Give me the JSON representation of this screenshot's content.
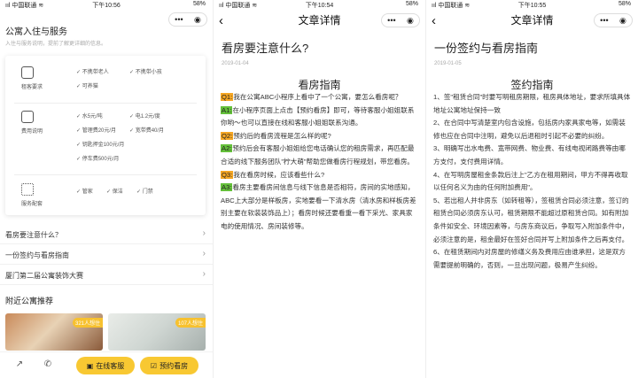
{
  "panel1": {
    "status": {
      "carrier": "ııl 中国联通 ≋",
      "time": "下午10:56",
      "battery": "58%"
    },
    "header_title": "公寓入住与服务",
    "header_sub": "入住与服务说明，提前了解更详细的信息。",
    "requirements": {
      "label": "租客要求",
      "tags": [
        "不携带老人",
        "不携带小孩",
        "可养猫"
      ]
    },
    "fees": {
      "label": "费用说明",
      "tags": [
        "水5元/吨",
        "电1.2元/度",
        "管理费20元/月",
        "宽带费40/月",
        "钥匙押金100元/月",
        "停车费500元/月"
      ]
    },
    "services": {
      "label": "服务配套",
      "tags": [
        "管家",
        "保洁",
        "门禁"
      ]
    },
    "links": [
      "看房要注意什么？",
      "一份签约与看房指南",
      "厦门第二届公寓装饰大赛"
    ],
    "nearby_title": "附近公寓推荐",
    "nearby": [
      {
        "badge": "321人想住"
      },
      {
        "badge": "107人想住"
      }
    ],
    "buttons": {
      "service": "在线客服",
      "viewing": "预约看房"
    }
  },
  "panel2": {
    "status": {
      "carrier": "ııl 中国联通 ≋",
      "time": "下午10:54",
      "battery": "58%"
    },
    "nav_title": "文章详情",
    "title": "看房要注意什么?",
    "date": "2019-01-04",
    "heading": "看房指南",
    "qa": [
      {
        "tag": "Q1:",
        "text": "我在公寓ABC小程序上看中了一个公寓，要怎么看房呢？"
      },
      {
        "tag": "A1:",
        "text": "在小程序页面上点击【预约看房】即可，等待客服小姐姐联系你哟～也可以直接在线和客服小姐姐联系沟通。"
      },
      {
        "tag": "Q2:",
        "text": "预约后的看房流程是怎么样的呢?"
      },
      {
        "tag": "A2:",
        "text": "预约后会有客服小姐姐给您电话确认您的租房需求，再匹配最合适的线下服务团队\"柠大萌\"帮助您做看房行程规划，带您看房。"
      },
      {
        "tag": "Q3:",
        "text": "我在看房时候，应该看些什么?"
      },
      {
        "tag": "A3:",
        "text": "看房主要看房间信息与线下信息是否相符，房间的实地感知，ABC上大部分是样板房，实地要看一下清水房（清水房和样板房差别主要在软装装饰品上）；看房时候还要看重一看下采光、家具家电的使用情况、房间装修等。"
      }
    ]
  },
  "panel3": {
    "status": {
      "carrier": "ııl 中国联通 ≋",
      "time": "下午10:55",
      "battery": "58%"
    },
    "nav_title": "文章详情",
    "title": "一份签约与看房指南",
    "date": "2019-01-05",
    "heading": "签约指南",
    "items": [
      "1、签\"租赁合同\"时要写明租房期限，租房具体地址，要求所填具体地址公寓地址保持一致",
      "2、在合同中写清楚室内包含设施，包括房内家具家电等，如需装修也应在合同中注明，避免以后退租时引起不必要的纠纷。",
      "3、明确写出水电费、宽带网费、物业费、有线电视闭路费等由哪方支付，支付费用详情。",
      "4、在写明房屋租金条款后注上\"乙方在租用期间，甲方不得再收取以任何名义为由的任何附加费用\"。",
      "5、若出租人并非房东（如转租等），签租赁合同必须注意，签订的租赁合同必须房东认可，租赁期限不能超过原租赁合同。如有附加条件如安全、环境因素等，与房东商议后，争取写入附加条件中，必须注意的是，租金最好在签好合同并写上附加条件之后再支付。",
      "6、在租赁期间内对房屋的修缮义务及费用应由谁承担，这是双方需要提前明确的，否则，一旦出现问题，极易产生纠纷。"
    ]
  }
}
